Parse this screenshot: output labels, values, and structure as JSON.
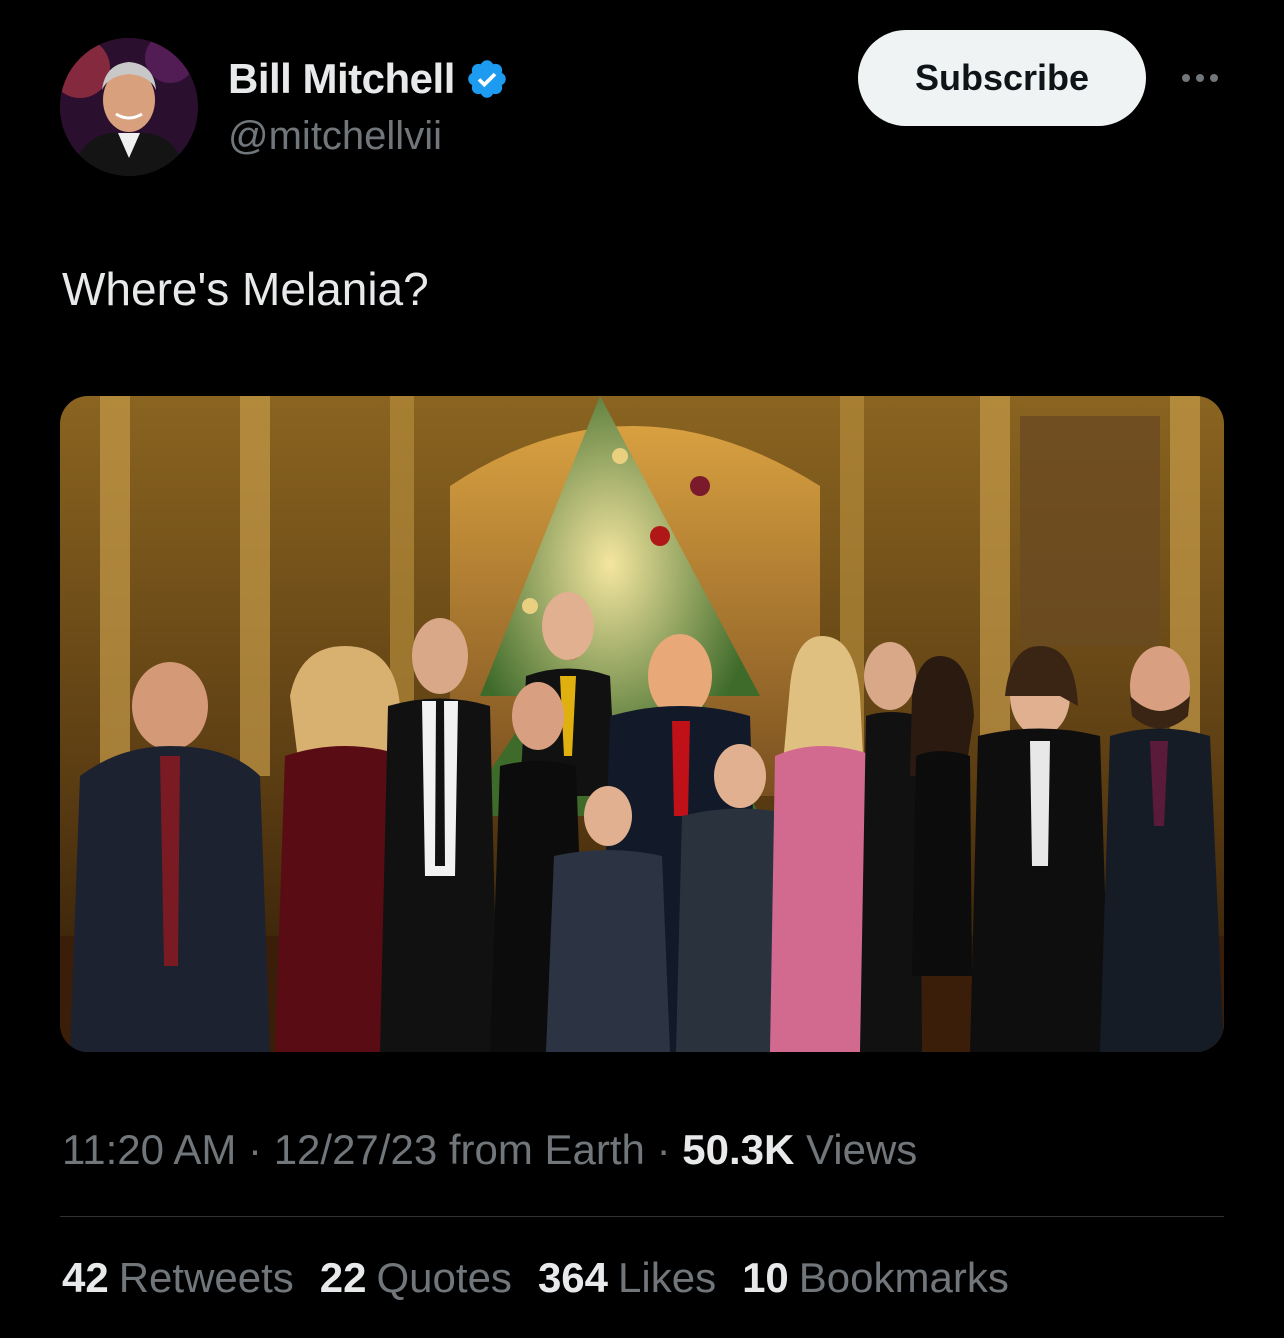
{
  "author": {
    "name": "Bill Mitchell",
    "handle": "@mitchellvii",
    "verified_icon": "verified-badge-icon",
    "verified_color": "#1d9bf0"
  },
  "actions": {
    "subscribe_label": "Subscribe",
    "more_icon": "more-dots-icon"
  },
  "tweet": {
    "text": "Where's Melania?"
  },
  "meta": {
    "time": "11:20 AM",
    "date_source": "12/27/23 from Earth",
    "separator": "·",
    "views_count": "50.3K",
    "views_label": "Views"
  },
  "stats": {
    "retweets": {
      "count": "42",
      "label": "Retweets"
    },
    "quotes": {
      "count": "22",
      "label": "Quotes"
    },
    "likes": {
      "count": "364",
      "label": "Likes"
    },
    "bookmarks": {
      "count": "10",
      "label": "Bookmarks"
    }
  },
  "colors": {
    "background": "#000000",
    "primary_text": "#e7e9ea",
    "secondary_text": "#71767b",
    "subscribe_bg": "#eff3f4"
  }
}
